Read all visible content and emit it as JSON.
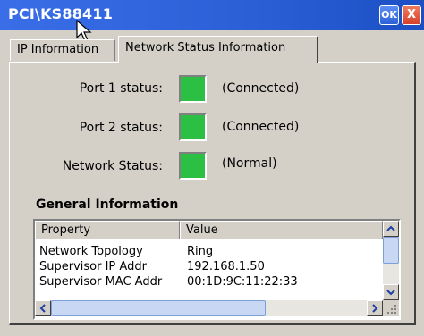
{
  "window": {
    "title": "PCI\\KS88411",
    "ok_label": "OK",
    "close_label": "X"
  },
  "tabs": [
    {
      "label": "IP Information",
      "active": false
    },
    {
      "label": "Network Status Information",
      "active": true
    }
  ],
  "status": [
    {
      "label": "Port 1 status:",
      "value": "(Connected)",
      "color": "#2bbf44"
    },
    {
      "label": "Port 2 status:",
      "value": "(Connected)",
      "color": "#2bbf44"
    },
    {
      "label": "Network Status:",
      "value": "(Normal)",
      "color": "#2bbf44"
    }
  ],
  "general": {
    "title": "General Information",
    "columns": [
      "Property",
      "Value"
    ],
    "rows": [
      {
        "property": "Network Topology",
        "value": "Ring"
      },
      {
        "property": "Supervisor IP Addr",
        "value": "192.168.1.50"
      },
      {
        "property": "Supervisor MAC Addr",
        "value": "00:1D:9C:11:22:33"
      }
    ]
  }
}
